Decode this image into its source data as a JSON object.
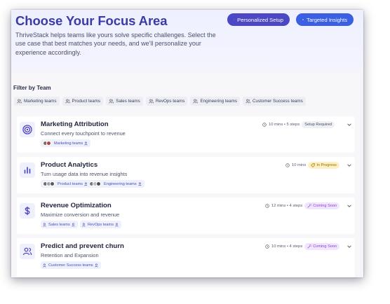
{
  "header": {
    "title": "Choose Your Focus Area",
    "subtitle": "ThriveStack helps teams like yours solve specific challenges. Select the use case that best matches your needs, and we'll personalize your experience accordingly.",
    "personalized_setup_label": "Personalized Setup",
    "targeted_insights_label": "Targeted Insights"
  },
  "filter": {
    "title": "Filter by Team",
    "teams": [
      "Marketing teams",
      "Product teams",
      "Sales teams",
      "RevOps teams",
      "Engineering teams",
      "Customer Success teams"
    ]
  },
  "use_cases": [
    {
      "title": "Marketing Attribution",
      "description": "Connect every touchpoint to revenue",
      "icon": "target-icon",
      "time": "10 mins • 5 steps",
      "status": "Setup Required",
      "status_kind": "required",
      "teams": [
        "Marketing teams"
      ]
    },
    {
      "title": "Product Analytics",
      "description": "Turn usage data into revenue insights",
      "icon": "bar-chart-icon",
      "time": "10 mins",
      "status": "In Progress",
      "status_kind": "progress",
      "teams": [
        "Product teams",
        "Engineering teams"
      ]
    },
    {
      "title": "Revenue Optimization",
      "description": "Maximize conversion and revenue",
      "icon": "dollar-icon",
      "time": "12 mins • 4 steps",
      "status": "Coming Soon",
      "status_kind": "soon",
      "teams": [
        "Sales teams",
        "RevOps teams"
      ]
    },
    {
      "title": "Predict and prevent churn",
      "description": "Retention and Expansion",
      "icon": "users-icon",
      "time": "10 mins • 4 steps",
      "status": "Coming Soon",
      "status_kind": "soon",
      "teams": [
        "Customer Success teams"
      ]
    }
  ],
  "colors": {
    "title": "#3a3aa8",
    "setup_button": "#4c47c4",
    "insights_button": "#3b5fe3",
    "in_progress": "#fdf1c4",
    "coming_soon": "#f1e6fd"
  }
}
